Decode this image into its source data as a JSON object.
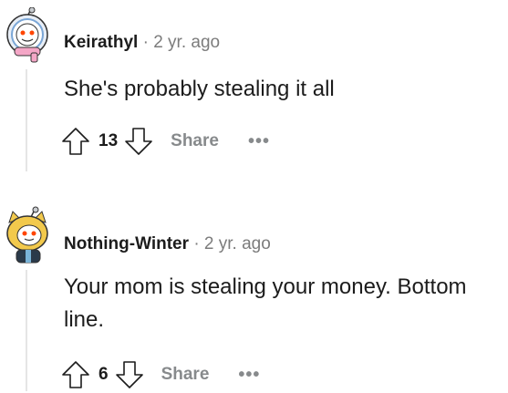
{
  "comments": [
    {
      "author": "Keirathyl",
      "separator": "·",
      "time": "2 yr. ago",
      "body_lines": [
        "She's probably stealing it all"
      ],
      "vote_count": "13",
      "share_label": "Share",
      "more_label": "•••",
      "avatar_icon": "snoo-avatar-winter-hood-icon"
    },
    {
      "author": "Nothing-Winter",
      "separator": "·",
      "time": "2 yr. ago",
      "body_lines": [
        "Your mom is stealing your money. Bottom",
        "line."
      ],
      "vote_count": "6",
      "share_label": "Share",
      "more_label": "•••",
      "avatar_icon": "snoo-avatar-doge-icon"
    }
  ],
  "colors": {
    "text_primary": "#1c1c1c",
    "text_secondary": "#7c7c7c",
    "action_gray": "#878a8c",
    "thread_line": "#e5e5e5"
  }
}
